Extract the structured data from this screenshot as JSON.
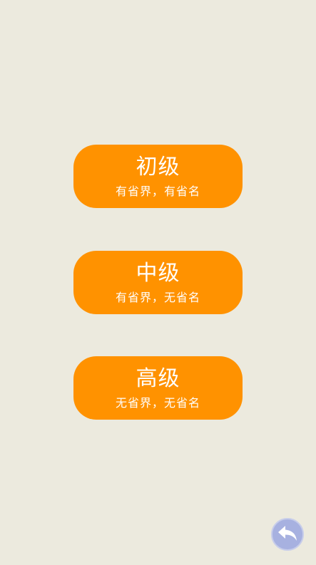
{
  "levels": [
    {
      "title": "初级",
      "subtitle": "有省界，有省名"
    },
    {
      "title": "中级",
      "subtitle": "有省界，无省名"
    },
    {
      "title": "高级",
      "subtitle": "无省界，无省名"
    }
  ],
  "back_button": {
    "icon": "undo-arrow-icon"
  },
  "colors": {
    "background": "#ECEADE",
    "button": "#FF9200",
    "button_text": "#FFFFFF",
    "back_button": "#A7B1E0"
  }
}
